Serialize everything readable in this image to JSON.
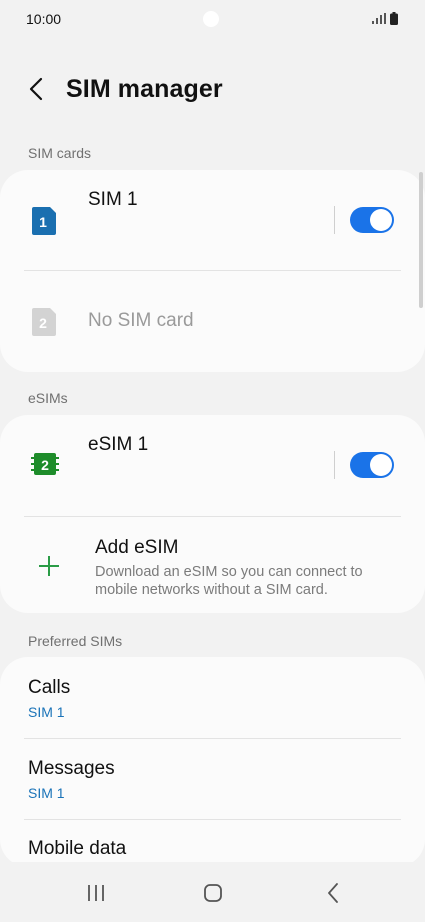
{
  "status_bar": {
    "time": "10:00"
  },
  "header": {
    "title": "SIM manager"
  },
  "sim_cards": {
    "section_label": "SIM cards",
    "sim1": {
      "badge": "1",
      "name": "SIM 1",
      "enabled": true,
      "color": "#1a6fb0"
    },
    "sim2": {
      "badge": "2",
      "name": "No SIM card",
      "color": "#d3d3d3"
    }
  },
  "esims": {
    "section_label": "eSIMs",
    "esim1": {
      "badge": "2",
      "name": "eSIM 1",
      "enabled": true,
      "color": "#1e8c2a"
    },
    "add": {
      "title": "Add eSIM",
      "subtitle_line1": "Download an eSIM so you can connect to",
      "subtitle_line2": "mobile networks without a SIM card.",
      "color": "#2a9c46"
    }
  },
  "preferred": {
    "section_label": "Preferred SIMs",
    "items": [
      {
        "title": "Calls",
        "value": "SIM 1"
      },
      {
        "title": "Messages",
        "value": "SIM 1"
      },
      {
        "title": "Mobile data"
      }
    ]
  },
  "colors": {
    "accent": "#1a73e8",
    "value_text": "#1a73b8"
  }
}
